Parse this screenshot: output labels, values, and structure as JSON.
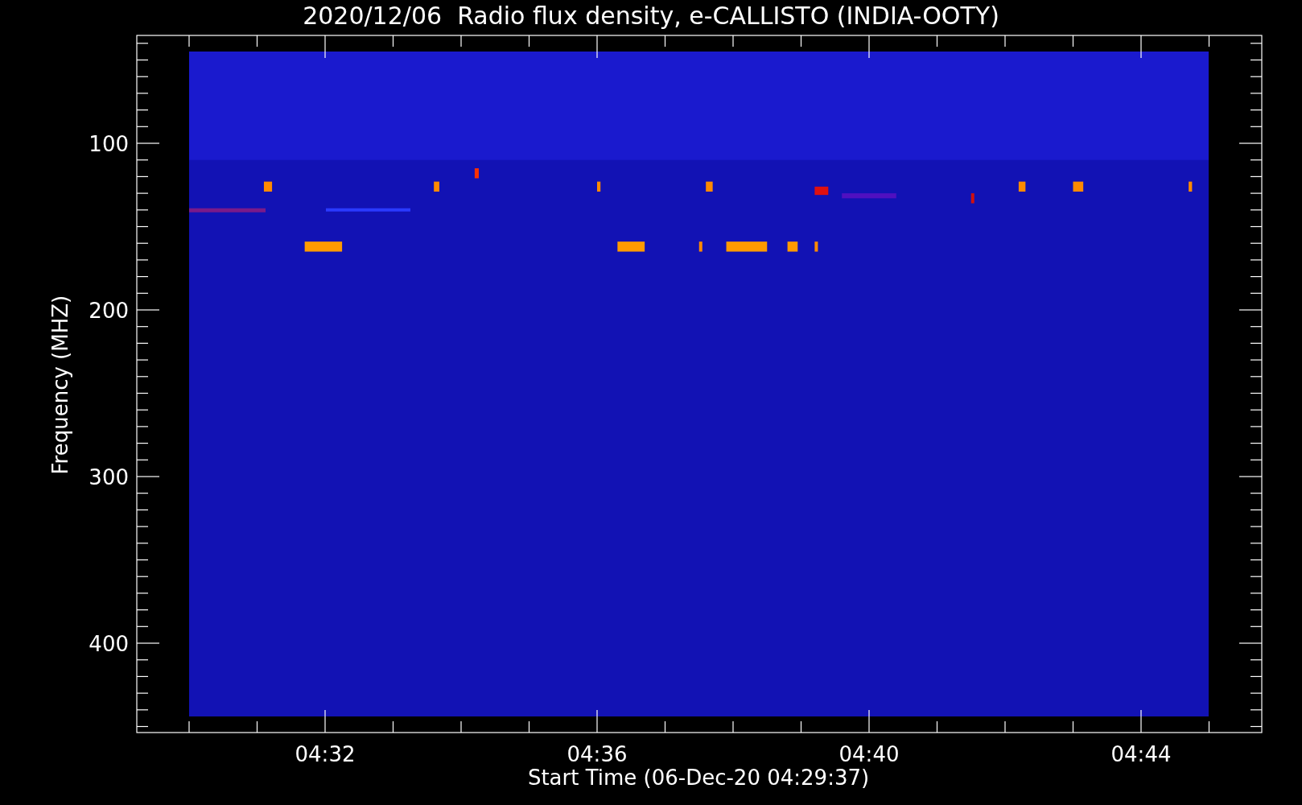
{
  "title": "2020/12/06  Radio flux density, e-CALLISTO (INDIA-OOTY)",
  "y_axis": {
    "label": "Frequency (MHZ)",
    "ticks": [
      "100",
      "200",
      "300",
      "400"
    ]
  },
  "x_axis": {
    "label": "Start Time (06-Dec-20 04:29:37)",
    "ticks": [
      "04:32",
      "04:36",
      "04:40",
      "04:44"
    ]
  }
}
